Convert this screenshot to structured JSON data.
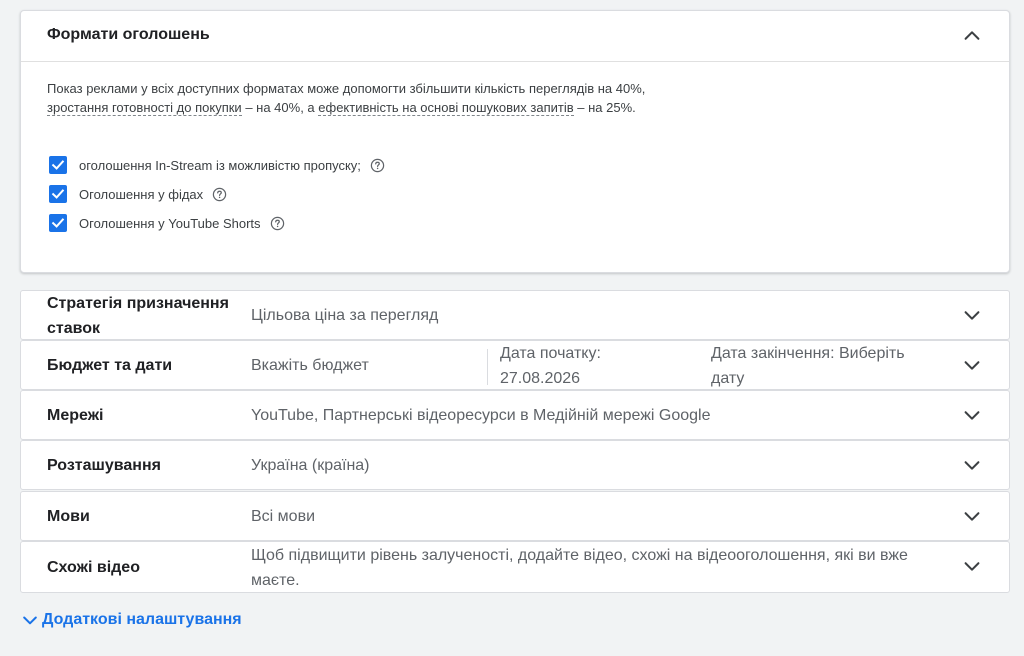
{
  "formats": {
    "title": "Формати оголошень",
    "description_part1": "Показ реклами у всіх доступних форматах може допомогти збільшити кількість переглядів на 40%, ",
    "description_link1": "зростання готовності до покупки",
    "description_part2": "  – на 40%, а ",
    "description_link2": "ефективність на основі пошукових запитів",
    "description_part3": "  – на 25%.",
    "options": [
      {
        "label": "оголошення In-Stream із можливістю пропуску;",
        "checked": true
      },
      {
        "label": "Оголошення у фідах",
        "checked": true
      },
      {
        "label": "Оголошення у YouTube Shorts",
        "checked": true
      }
    ]
  },
  "sections": {
    "bidding": {
      "label": "Стратегія призначення ставок",
      "value": "Цільова ціна за перегляд"
    },
    "budget": {
      "label": "Бюджет та дати",
      "value": "Вкажіть бюджет",
      "start_date": "Дата початку: 27.08.2026",
      "end_date": "Дата закінчення: Виберіть дату"
    },
    "networks": {
      "label": "Мережі",
      "value": "YouTube, Партнерські відеоресурси в Медійній мережі Google"
    },
    "locations": {
      "label": "Розташування",
      "value": "Україна (країна)"
    },
    "languages": {
      "label": "Мови",
      "value": "Всі мови"
    },
    "related_videos": {
      "label": "Схожі відео",
      "value": "Щоб підвищити рівень залученості, додайте відео, схожі на відеооголошення, які ви вже маєте."
    }
  },
  "additional_settings": "Додаткові налаштування",
  "colors": {
    "accent": "#1a73e8",
    "text": "#202124",
    "muted": "#5f6368",
    "background": "#f1f3f4"
  }
}
